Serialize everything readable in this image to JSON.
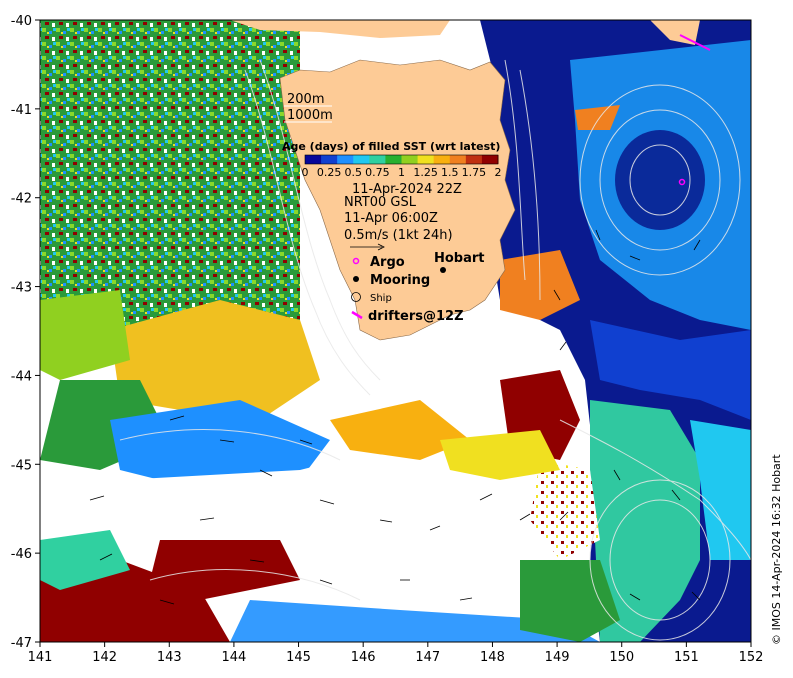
{
  "map": {
    "x_ticks": [
      "141",
      "142",
      "143",
      "144",
      "145",
      "146",
      "147",
      "148",
      "149",
      "150",
      "151",
      "152"
    ],
    "y_ticks": [
      "-40",
      "-41",
      "-42",
      "-43",
      "-44",
      "-45",
      "-46",
      "-47"
    ],
    "lon_range": [
      141,
      152
    ],
    "lat_range": [
      -47,
      -40
    ],
    "place_label": "Hobart"
  },
  "contours": {
    "line1": "200m",
    "line2": "1000m"
  },
  "colorbar": {
    "title": "Age (days) of filled SST (wrt latest)",
    "tick_labels": [
      "0",
      "0.25",
      "0.5",
      "0.75",
      "1",
      "1.25",
      "1.5",
      "1.75",
      "2"
    ],
    "colors": [
      "#07069a",
      "#1040d0",
      "#1e90ff",
      "#20c8f0",
      "#30d0a0",
      "#28b030",
      "#90d020",
      "#f0e020",
      "#f8b010",
      "#f08020",
      "#c03010",
      "#900000"
    ]
  },
  "info": {
    "date_line": "11-Apr-2024 22Z",
    "product": "NRT00 GSL",
    "current_time": "11-Apr 06:00Z",
    "scale_label": "0.5m/s (1kt 24h)"
  },
  "legend": {
    "argo": "Argo",
    "mooring": "Mooring",
    "ship": "Ship",
    "drifters": "drifters@12Z"
  },
  "credit": "© IMOS 14-Apr-2024 16:32 Hobart",
  "colors": {
    "land": "#fdcb96",
    "deep_blue": "#0a1a8f",
    "argo": "#ff00ff"
  }
}
